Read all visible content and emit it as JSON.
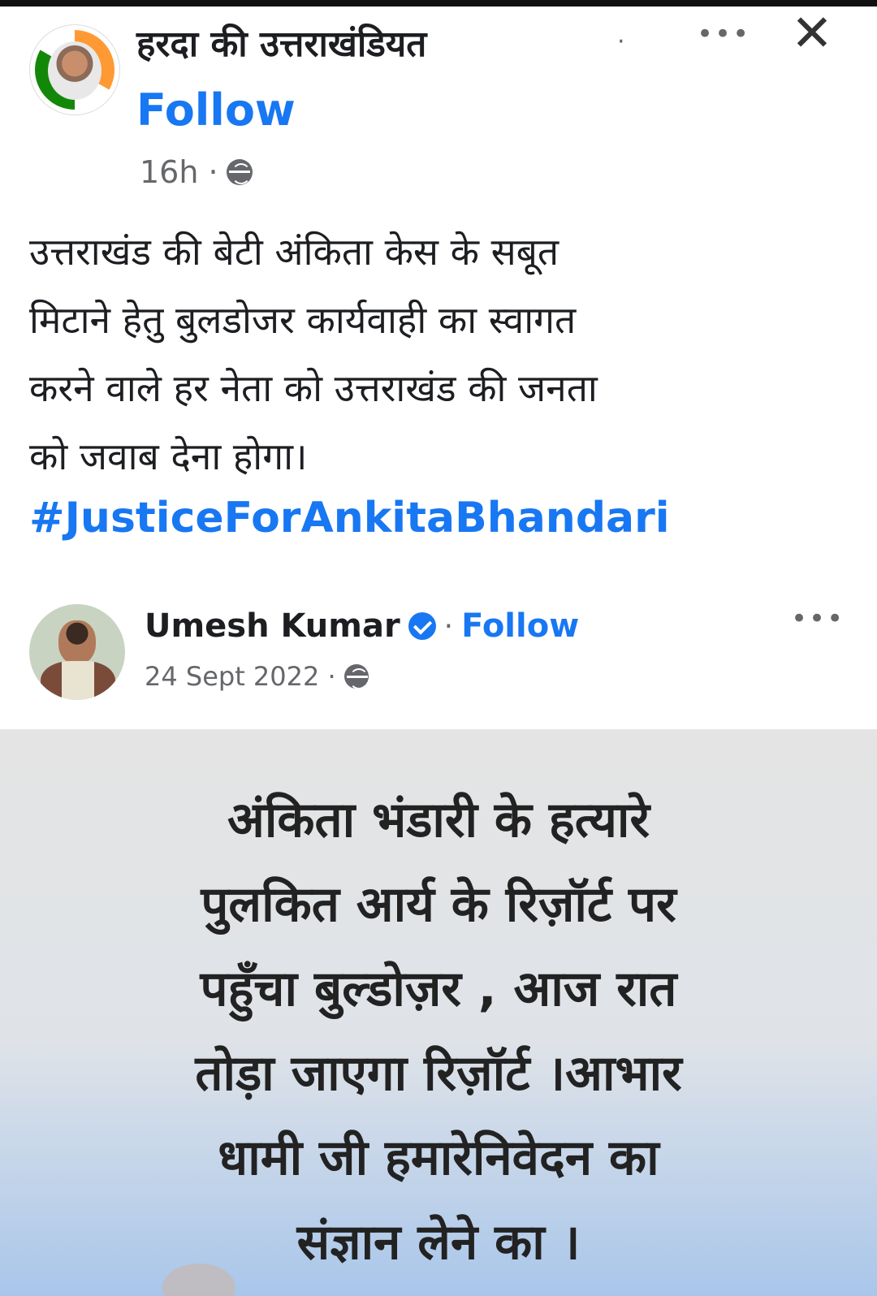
{
  "post": {
    "page_name": "हरदा की उत्तराखंडियत",
    "separator": "·",
    "follow_label": "Follow",
    "time": "16h ·",
    "more_label": "•••",
    "close_label": "✕",
    "text_lines": [
      "उत्तराखंड की बेटी अंकिता केस के सबूत",
      "मिटाने हेतु बुलडोजर कार्यवाही का स्वागत",
      "करने वाले हर नेता को उत्तराखंड की जनता",
      "को जवाब देना होगा।"
    ],
    "hashtag": "#JusticeForAnkitaBhandari"
  },
  "shared_post": {
    "author": "Umesh Kumar",
    "separator": "·",
    "follow_label": "Follow",
    "date": "24 Sept 2022 ·",
    "more_label": "•••",
    "image_text_lines": [
      "अंकिता भंडारी के हत्यारे",
      "पुलकित आर्य के रिज़ॉर्ट पर",
      "पहुँचा बुल्डोज़र , आज रात",
      "तोड़ा जाएगा रिज़ॉर्ट ।आभार",
      "धामी जी हमारेनिवेदन का",
      "संज्ञान लेने का ।"
    ]
  },
  "icons": {
    "globe": "globe-icon",
    "verified": "verified-badge-icon",
    "more": "more-options-icon",
    "close": "close-icon"
  },
  "colors": {
    "link_blue": "#1877f2",
    "text": "#1c1e21",
    "meta_gray": "#65676b"
  }
}
